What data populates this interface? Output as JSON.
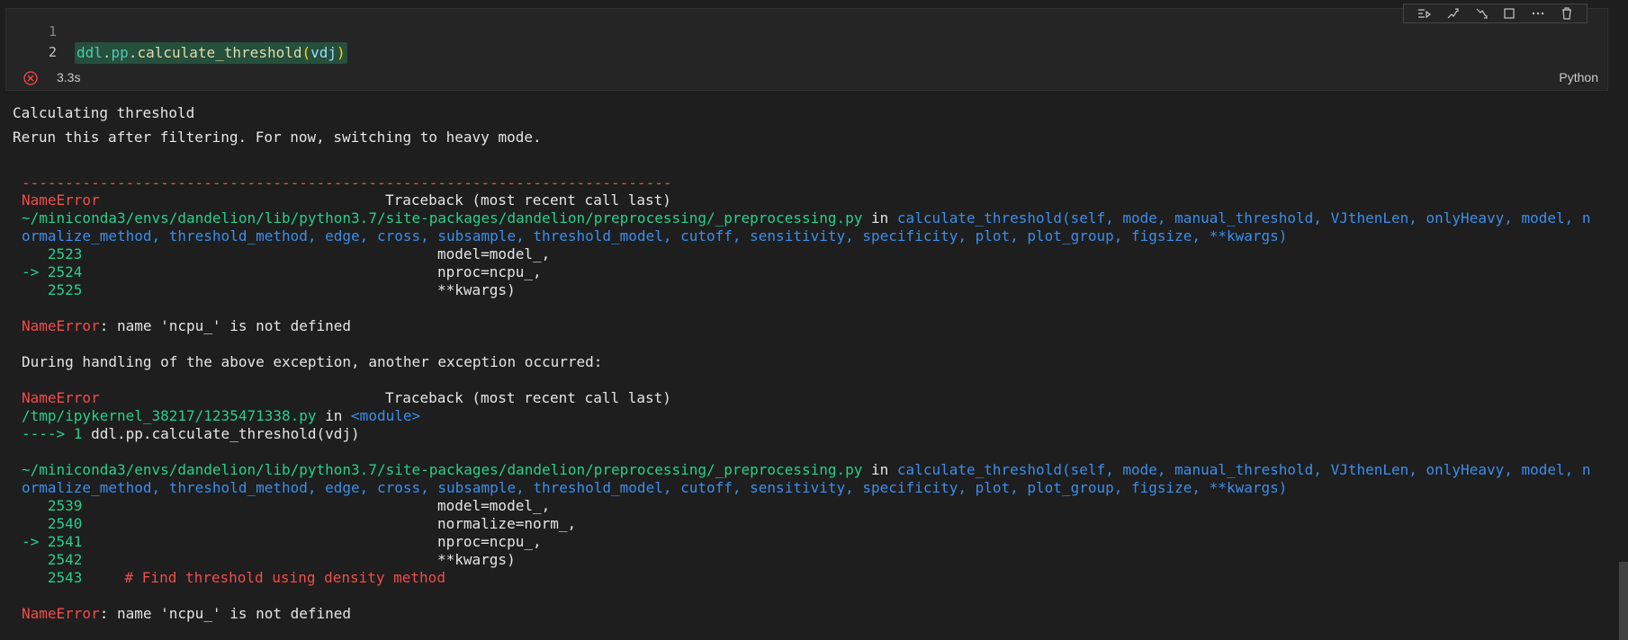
{
  "cell": {
    "lines": [
      {
        "number": "1",
        "text": ""
      },
      {
        "number": "2",
        "tokens": [
          "ddl",
          ".",
          "pp",
          ".",
          "calculate_threshold",
          "(",
          "vdj",
          ")"
        ]
      }
    ],
    "status_time": "3.3s",
    "language": "Python",
    "toolbar_icons": [
      "run-by-line-icon",
      "execute-above-icon",
      "execute-below-icon",
      "split-cell-icon",
      "more-actions-icon",
      "delete-cell-icon"
    ]
  },
  "output": {
    "stdout": [
      "Calculating threshold",
      "Rerun this after filtering. For now, switching to heavy mode."
    ],
    "dashes": "---------------------------------------------------------------------------",
    "tb1": {
      "error_name": "NameError",
      "traceback_label": "Traceback (most recent call last)",
      "file_path": "~/miniconda3/envs/dandelion/lib/python3.7/site-packages/dandelion/preprocessing/_preprocessing.py",
      "in_word": " in ",
      "func_sig_1": "calculate_threshold(self, mode, manual_threshold, VJthenLen, onlyHeavy, model, n",
      "func_sig_2": "ormalize_method, threshold_method, edge, cross, subsample, threshold_model, cutoff, sensitivity, specificity, plot, plot_group, figsize, **kwargs)",
      "lines": [
        {
          "prefix": "   2523",
          "code": "model=model_,"
        },
        {
          "prefix": "-> 2524",
          "code": "nproc=ncpu_,"
        },
        {
          "prefix": "   2525",
          "code": "**kwargs)"
        }
      ],
      "message": ": name 'ncpu_' is not defined"
    },
    "during_handling": "During handling of the above exception, another exception occurred:",
    "tb2": {
      "error_name": "NameError",
      "traceback_label": "Traceback (most recent call last)",
      "file_path": "/tmp/ipykernel_38217/1235471338.py",
      "in_word": " in ",
      "module": "<module>",
      "arrow_line_prefix": "----> 1 ",
      "arrow_line_code": "ddl.pp.calculate_threshold(vdj)"
    },
    "tb3": {
      "file_path": "~/miniconda3/envs/dandelion/lib/python3.7/site-packages/dandelion/preprocessing/_preprocessing.py",
      "in_word": " in ",
      "func_sig_1": "calculate_threshold(self, mode, manual_threshold, VJthenLen, onlyHeavy, model, n",
      "func_sig_2": "ormalize_method, threshold_method, edge, cross, subsample, threshold_model, cutoff, sensitivity, specificity, plot, plot_group, figsize, **kwargs)",
      "lines": [
        {
          "prefix": "   2539",
          "code": "model=model_,"
        },
        {
          "prefix": "   2540",
          "code": "normalize=norm_,"
        },
        {
          "prefix": "-> 2541",
          "code": "nproc=ncpu_,"
        },
        {
          "prefix": "   2542",
          "code": "**kwargs)"
        },
        {
          "prefix": "   2543",
          "code": "    # Find threshold using density method"
        }
      ],
      "error_name": "NameError",
      "message": ": name 'ncpu_' is not defined"
    }
  }
}
